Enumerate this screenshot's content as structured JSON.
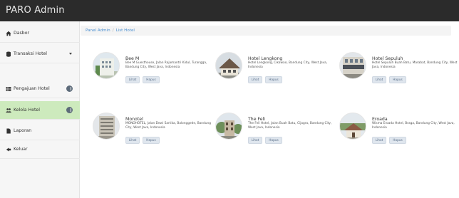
{
  "app": {
    "title": "PARO Admin"
  },
  "sidebar": {
    "items": [
      {
        "label": "Dasbor",
        "icon": "home-icon"
      },
      {
        "label": "Transaksi Hotel",
        "icon": "database-icon",
        "has_caret": true
      },
      {
        "label": "Pengajuan Hotel",
        "icon": "table-icon",
        "has_badge": true
      },
      {
        "label": "Kelola Hotel",
        "icon": "users-icon",
        "has_badge": true,
        "active": true
      },
      {
        "label": "Laporan",
        "icon": "file-icon"
      },
      {
        "label": "Keluar",
        "icon": "logout-icon"
      }
    ],
    "active_color": "#cdeabd"
  },
  "breadcrumb": {
    "root": "Panel Admin",
    "separator": "/",
    "current": "List Hotel"
  },
  "hotels": [
    {
      "name": "Bee M",
      "address": "Bee M Guesthouse, Jalan Rajamantri Kidul, Turangga, Bandung City, West Java, Indonesia",
      "view_label": "Lihat",
      "delete_label": "Hapus"
    },
    {
      "name": "Hotel Lengkong",
      "address": "Hotel Lengkong, Cikawao, Bandung City, West Java, Indonesia",
      "view_label": "Lihat",
      "delete_label": "Hapus"
    },
    {
      "name": "Hotel Sepuluh",
      "address": "Hotel Sepuluh Buah Batu, Marabat, Bandung City, West Java, Indonesia",
      "view_label": "Lihat",
      "delete_label": "Hapus"
    },
    {
      "name": "Monotel",
      "address": "MONOHOTEL, Jalan Dewi Sartika, Balonggede, Bandung City, West Java, Indonesia",
      "view_label": "Lihat",
      "delete_label": "Hapus"
    },
    {
      "name": "The Feli",
      "address": "The Feli Hotel, Jalan Buah Batu, Cijagra, Bandung City, West Java, Indonesia",
      "view_label": "Lihat",
      "delete_label": "Hapus"
    },
    {
      "name": "Eroada",
      "address": "Wisma Eroada Hotel, Braga, Bandung City, West Java, Indonesia",
      "view_label": "Lihat",
      "delete_label": "Hapus"
    }
  ]
}
